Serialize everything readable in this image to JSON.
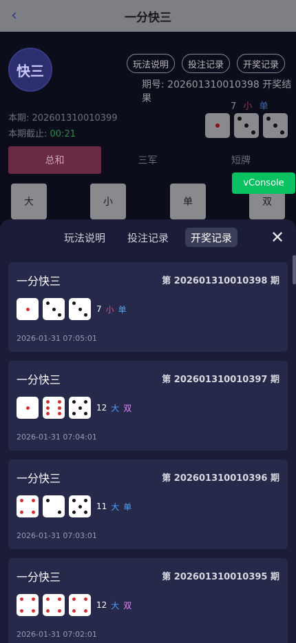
{
  "header": {
    "title": "一分快三",
    "back_icon": "‹"
  },
  "logo": {
    "text": "快三"
  },
  "top_buttons": [
    "玩法说明",
    "投注记录",
    "开奖记录"
  ],
  "last_issue_text": "期号: 202601310010398 开奖结果",
  "last_result": {
    "sum": "7",
    "size": "小",
    "parity": "单",
    "dice": [
      1,
      3,
      3
    ]
  },
  "current_issue_text": "本期: 202601310010399",
  "cutoff": {
    "label": "本期截止: ",
    "time": "00:21"
  },
  "play_tabs": [
    "总和",
    "三军",
    "短牌"
  ],
  "bet_options": [
    "大",
    "小",
    "单",
    "双"
  ],
  "vconsole_label": "vConsole",
  "sheet": {
    "tabs": [
      "玩法说明",
      "投注记录",
      "开奖记录"
    ],
    "active_tab": "开奖记录",
    "close_icon": "✕",
    "records": [
      {
        "name": "一分快三",
        "issue": "第 202601310010398 期",
        "dice": [
          1,
          3,
          3
        ],
        "sum": "7",
        "size": "小",
        "parity": "单",
        "time": "2026-01-31 07:05:01"
      },
      {
        "name": "一分快三",
        "issue": "第 202601310010397 期",
        "dice": [
          1,
          6,
          5
        ],
        "sum": "12",
        "size": "大",
        "parity": "双",
        "time": "2026-01-31 07:04:01"
      },
      {
        "name": "一分快三",
        "issue": "第 202601310010396 期",
        "dice": [
          4,
          2,
          5
        ],
        "sum": "11",
        "size": "大",
        "parity": "单",
        "time": "2026-01-31 07:03:01"
      },
      {
        "name": "一分快三",
        "issue": "第 202601310010395 期",
        "dice": [
          4,
          4,
          4
        ],
        "sum": "12",
        "size": "大",
        "parity": "双",
        "time": "2026-01-31 07:02:01"
      }
    ]
  }
}
